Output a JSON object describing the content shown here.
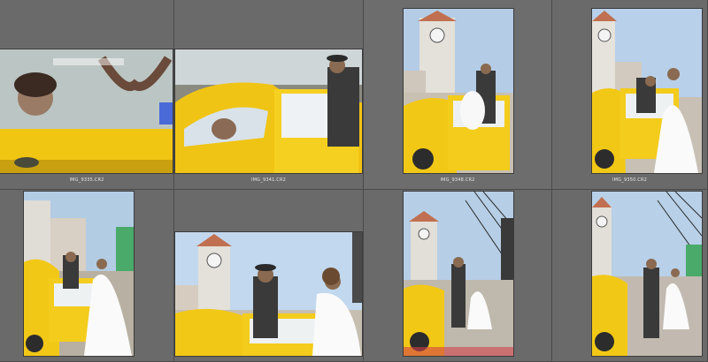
{
  "thumbnails": [
    {
      "filename": "IMG_9335.CR2",
      "scene": "heart-hands-through-glass"
    },
    {
      "filename": "IMG_9341.CR2",
      "scene": "couple-at-car-door"
    },
    {
      "filename": "IMG_9348.CR2",
      "scene": "clock-tower-couple-car"
    },
    {
      "filename": "IMG_9350.CR2",
      "scene": "clock-tower-couple-kiss"
    },
    {
      "filename": "",
      "scene": "street-couple-car"
    },
    {
      "filename": "",
      "scene": "clock-tower-groom-gesture"
    },
    {
      "filename": "",
      "scene": "street-couple-walk"
    },
    {
      "filename": "",
      "scene": "street-couple-walk-2"
    }
  ],
  "colors": {
    "panel": "#6a6a6a",
    "grid_line": "#4a4a4a",
    "car_yellow": "#f2c81a",
    "sky": "#a8c8e8"
  }
}
